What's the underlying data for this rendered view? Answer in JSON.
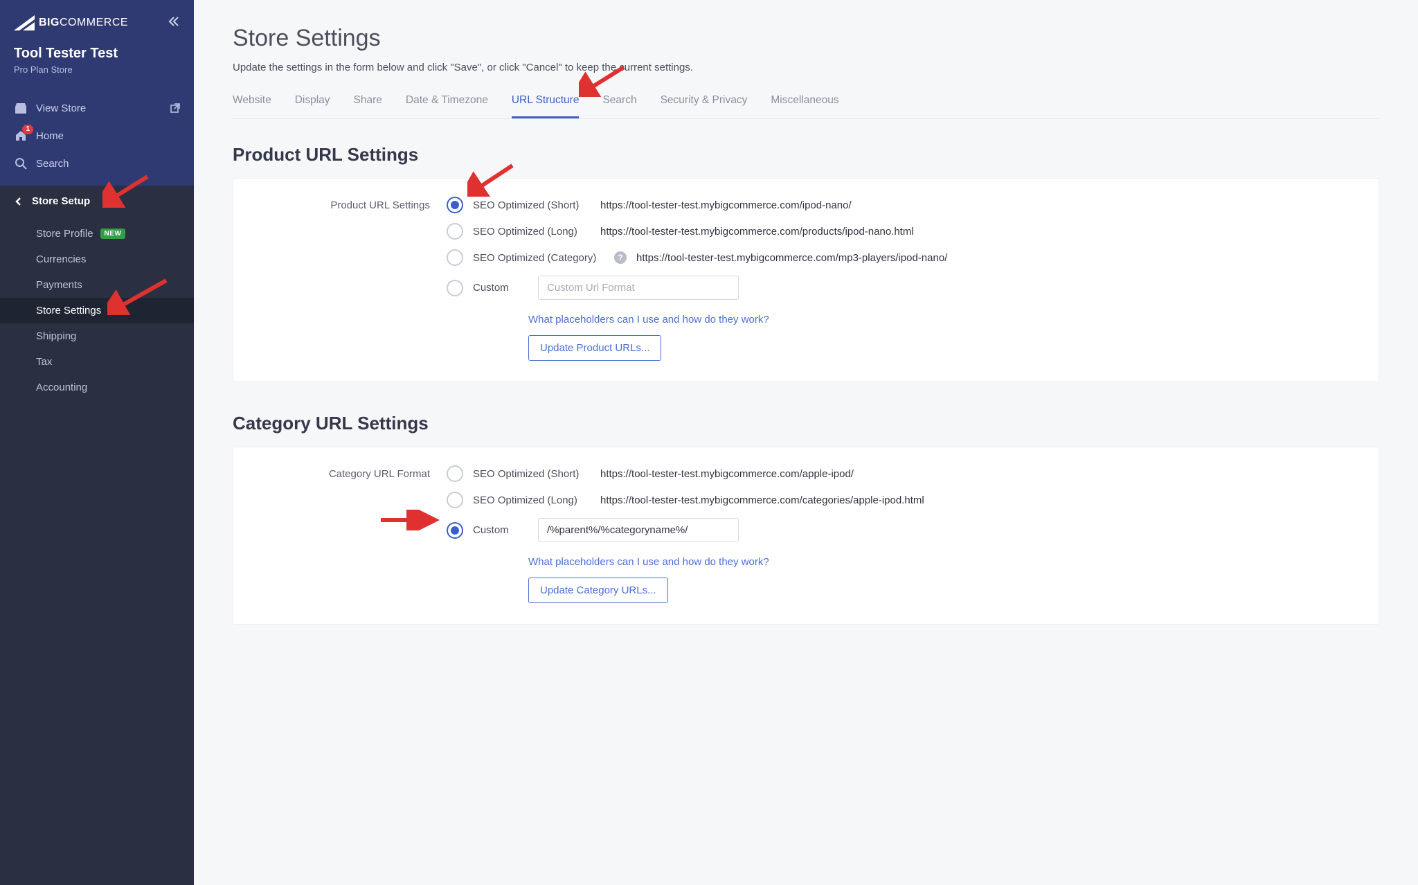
{
  "brand": {
    "big": "BIG",
    "commerce": "COMMERCE"
  },
  "store": {
    "name": "Tool Tester Test",
    "plan": "Pro Plan Store"
  },
  "primaryLinks": {
    "viewStore": "View Store",
    "home": "Home",
    "homeBadge": "1",
    "search": "Search"
  },
  "sectionHead": "Store Setup",
  "subLinks": {
    "storeProfile": "Store Profile",
    "newBadge": "NEW",
    "currencies": "Currencies",
    "payments": "Payments",
    "storeSettings": "Store Settings",
    "shipping": "Shipping",
    "tax": "Tax",
    "accounting": "Accounting"
  },
  "page": {
    "title": "Store Settings",
    "subtitle": "Update the settings in the form below and click \"Save\", or click \"Cancel\" to keep the current settings."
  },
  "tabs": {
    "website": "Website",
    "display": "Display",
    "share": "Share",
    "dateTimezone": "Date & Timezone",
    "urlStructure": "URL Structure",
    "search": "Search",
    "securityPrivacy": "Security & Privacy",
    "miscellaneous": "Miscellaneous"
  },
  "productSection": {
    "title": "Product URL Settings",
    "fieldLabel": "Product URL Settings",
    "options": {
      "short": {
        "label": "SEO Optimized (Short)",
        "example": "https://tool-tester-test.mybigcommerce.com/ipod-nano/"
      },
      "long": {
        "label": "SEO Optimized (Long)",
        "example": "https://tool-tester-test.mybigcommerce.com/products/ipod-nano.html"
      },
      "category": {
        "label": "SEO Optimized (Category)",
        "example": "https://tool-tester-test.mybigcommerce.com/mp3-players/ipod-nano/"
      },
      "custom": {
        "label": "Custom",
        "placeholder": "Custom Url Format"
      }
    },
    "helpLink": "What placeholders can I use and how do they work?",
    "updateBtn": "Update Product URLs..."
  },
  "categorySection": {
    "title": "Category URL Settings",
    "fieldLabel": "Category URL Format",
    "options": {
      "short": {
        "label": "SEO Optimized (Short)",
        "example": "https://tool-tester-test.mybigcommerce.com/apple-ipod/"
      },
      "long": {
        "label": "SEO Optimized (Long)",
        "example": "https://tool-tester-test.mybigcommerce.com/categories/apple-ipod.html"
      },
      "custom": {
        "label": "Custom",
        "value": "/%parent%/%categoryname%/"
      }
    },
    "helpLink": "What placeholders can I use and how do they work?",
    "updateBtn": "Update Category URLs..."
  },
  "helpTooltip": "?"
}
